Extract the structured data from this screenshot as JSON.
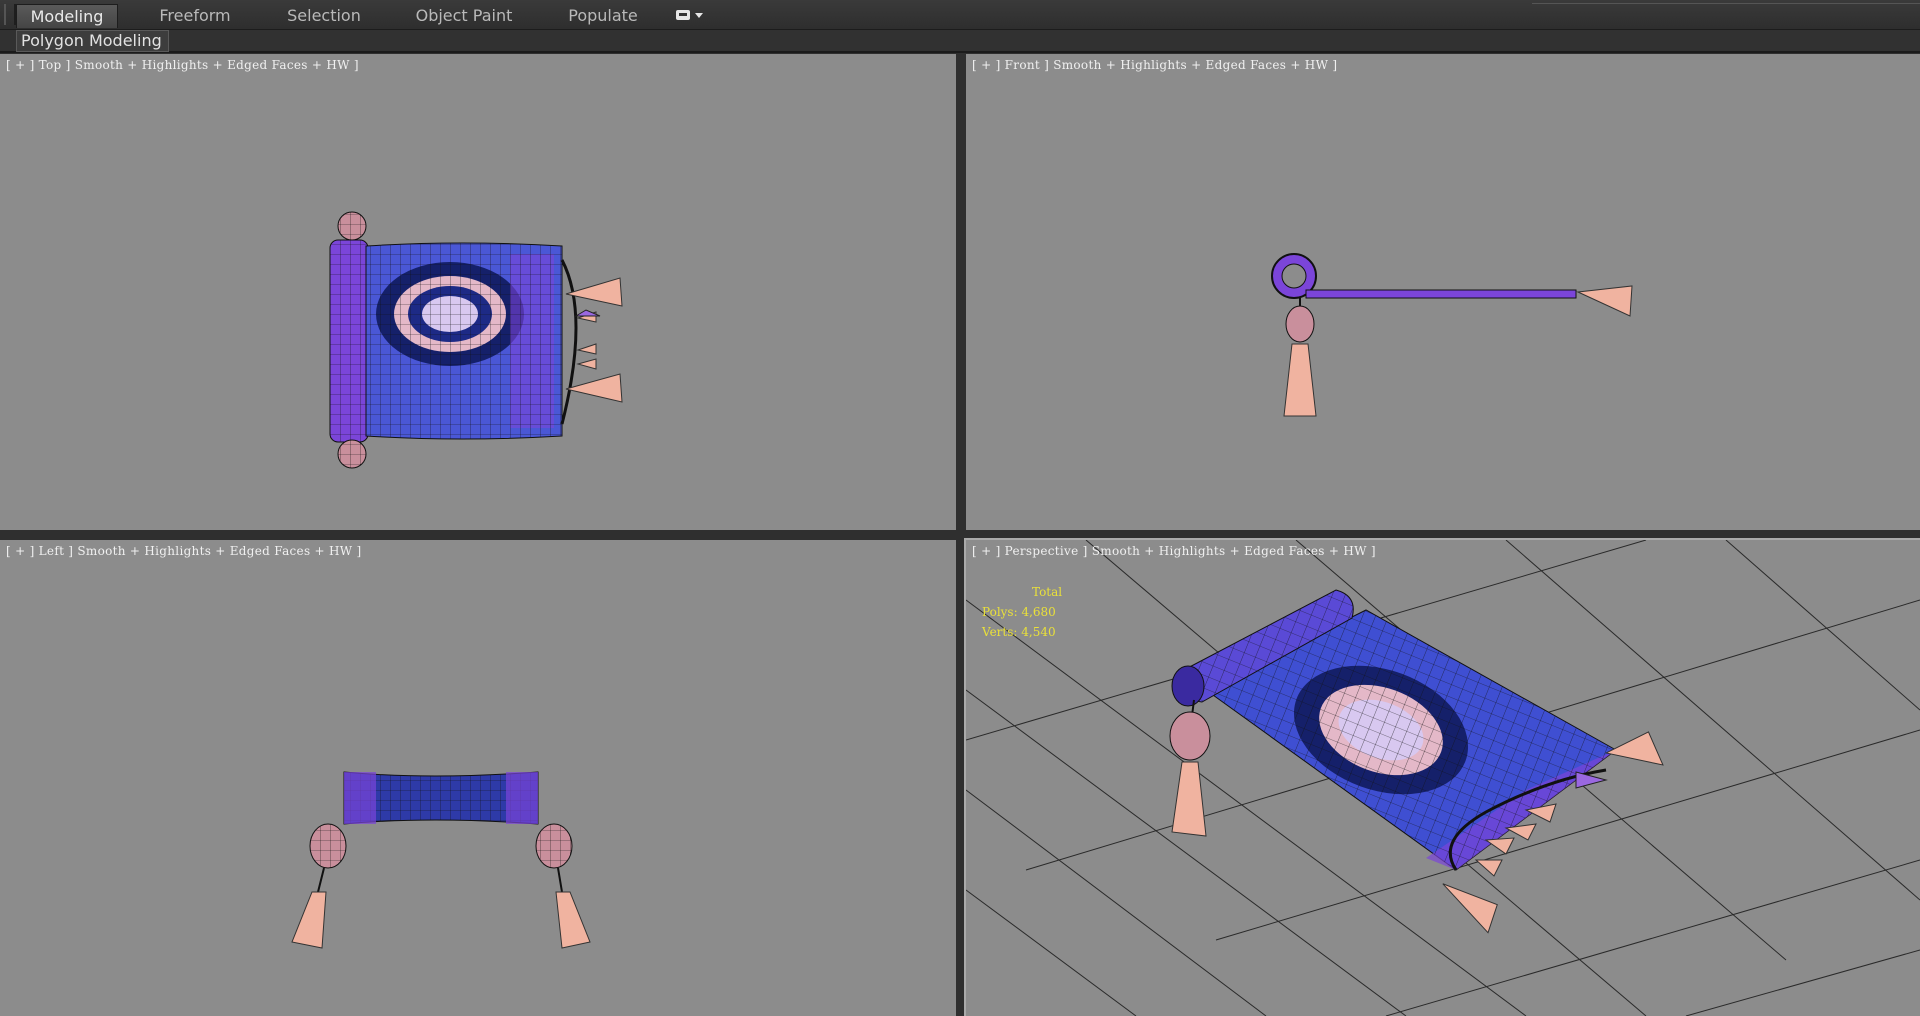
{
  "ribbon": {
    "tabs": [
      "Modeling",
      "Freeform",
      "Selection",
      "Object Paint",
      "Populate"
    ],
    "active_tab": "Modeling"
  },
  "subbar": {
    "panel_label": "Polygon Modeling"
  },
  "viewports": {
    "top": {
      "label": "[ + ] Top ] Smooth + Highlights + Edged Faces + HW ]"
    },
    "front": {
      "label": "[ + ] Front ] Smooth + Highlights + Edged Faces + HW ]"
    },
    "left": {
      "label": "[ + ] Left ] Smooth + Highlights + Edged Faces + HW ]"
    },
    "perspective": {
      "label": "[ + ] Perspective ] Smooth + Highlights + Edged Faces + HW ]",
      "stats": {
        "total": "Total",
        "polys": "Polys: 4,680",
        "verts": "Verts: 4,540"
      }
    }
  },
  "colors": {
    "viewport_bg": "#8c8c8c",
    "carpet_purple": "#7b45d9",
    "carpet_blue": "#2e3aa8",
    "carpet_navy": "#15206a",
    "tassel_pink": "#f0b3a0",
    "stats_yellow": "#e9e03a"
  }
}
